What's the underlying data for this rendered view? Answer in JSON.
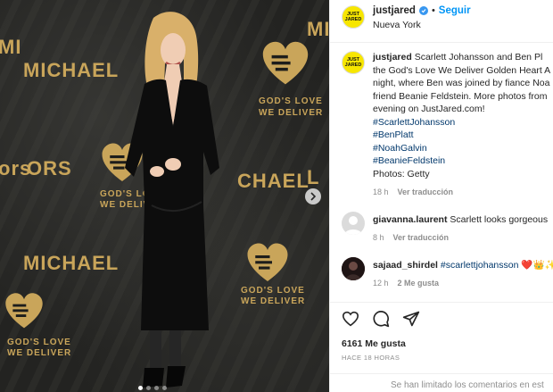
{
  "media": {
    "backdrop_texts": [
      "MI",
      "MICHAEL",
      "ORS",
      "GOD'S LOVE",
      "WE DELIVER",
      "GOD'S LOVE",
      "WE DELIVER",
      "L",
      "CHAEL",
      "MICHAEL",
      "GOD'S LOVE",
      "WE DELIVER",
      "ors",
      "GOD'S LOVE",
      "WE DELIVER",
      "MI"
    ],
    "slide_count": 4,
    "active_slide": 0
  },
  "header": {
    "avatar_text": "JUST JARED",
    "username": "justjared",
    "separator": "•",
    "follow_label": "Seguir",
    "location": "Nueva York"
  },
  "caption": {
    "username": "justjared",
    "lines": [
      "Scarlett Johansson and Ben Pl",
      "the God's Love We Deliver Golden Heart A",
      "night, where Ben was joined by fiance Noa",
      "friend Beanie Feldstein. More photos from",
      "evening on JustJared.com!"
    ],
    "hashtags": [
      "#ScarlettJohansson",
      "#BenPlatt",
      "#NoahGalvin",
      "#BeanieFeldstein"
    ],
    "credit": "Photos: Getty",
    "time": "18 h",
    "translate_label": "Ver traducción"
  },
  "comments": [
    {
      "username": "giavanna.laurent",
      "text": "Scarlett looks gorgeous",
      "time": "8 h",
      "translate_label": "Ver traducción"
    },
    {
      "username": "sajaad_shirdel",
      "text": "#scarlettjohansson",
      "emojis": "❤️👑✨",
      "time": "12 h",
      "likes_label": "2 Me gusta"
    }
  ],
  "actions": {
    "likes": "6161 Me gusta",
    "time_ago": "HACE 18 HORAS"
  },
  "footer": {
    "text": "Se han limitado los comentarios en est"
  },
  "colors": {
    "link": "#00376b",
    "follow": "#0095f6",
    "gold": "#c9a55a",
    "avatar_yellow": "#f7e600"
  }
}
